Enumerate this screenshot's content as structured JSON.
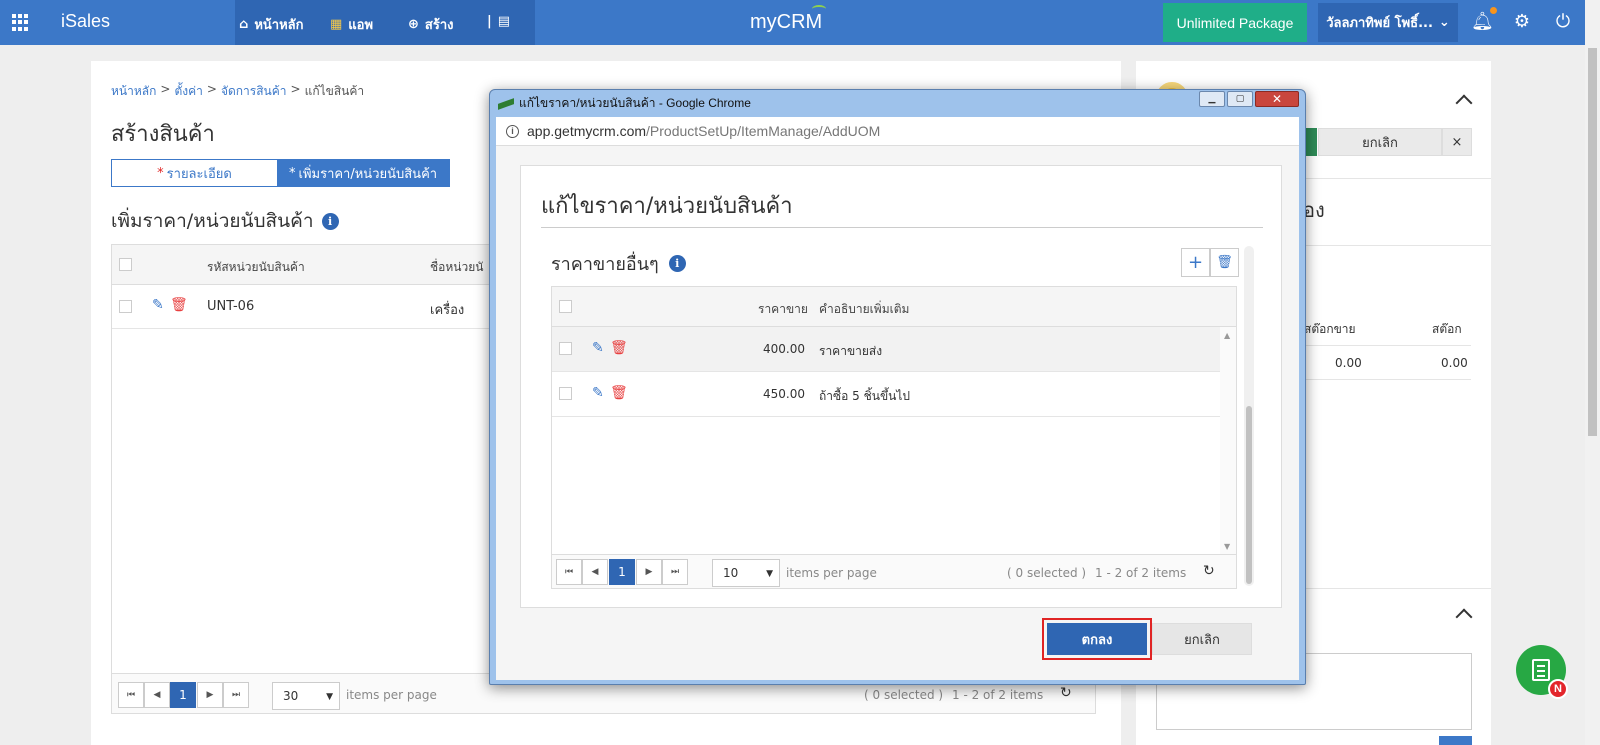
{
  "topbar": {
    "brand": "iSales",
    "nav": [
      {
        "label": "หน้าหลัก",
        "icon": "home-icon"
      },
      {
        "label": "แอพ",
        "icon": "apps-icon"
      },
      {
        "label": "สร้าง",
        "icon": "plus-circle-icon"
      }
    ],
    "center_logo": "myCRM",
    "package_label": "Unlimited Package",
    "user_label": "วัลลภาทิพย์ โพธิ์..."
  },
  "breadcrumb": [
    "หน้าหลัก",
    "ตั้งค่า",
    "จัดการสินค้า",
    "แก้ไขสินค้า"
  ],
  "breadcrumb_sep": ">",
  "page_title": "สร้างสินค้า",
  "tabs": [
    {
      "label": "รายละเอียด",
      "required": "*"
    },
    {
      "label": "เพิ่มราคา/หน่วยนับสินค้า",
      "required": "*"
    }
  ],
  "section_title": "เพิ่มราคา/หน่วยนับสินค้า",
  "main_grid": {
    "columns": [
      "รหัสหน่วยนับสินค้า",
      "ชื่อหน่วยนั"
    ],
    "rows": [
      {
        "code": "UNT-06",
        "name": "เครื่อง"
      }
    ],
    "pager": {
      "page": "1",
      "page_size": "30",
      "per_page_label": "items per page",
      "selected_label": "( 0 selected )",
      "range_label": "1 - 2 of 2 items"
    }
  },
  "right_panel": {
    "cancel_label": "ยกเลิก",
    "close_label": "×",
    "partial_heading": "อง",
    "stock_sell_header": "สต๊อกขาย",
    "stock_header": "สต๊อก",
    "stock_sell_value": "0.00",
    "stock_value": "0.00"
  },
  "popup": {
    "window_title": "แก้ไขราคา/หน่วยนับสินค้า - Google Chrome",
    "url_host": "app.getmycrm.com",
    "url_path": "/ProductSetUp/ItemManage/AddUOM",
    "dialog_title": "แก้ไขราคา/หน่วยนับสินค้า",
    "sub_title": "ราคาขายอื่นๆ",
    "columns": [
      "ราคาขาย",
      "คำอธิบายเพิ่มเติม"
    ],
    "rows": [
      {
        "price": "400.00",
        "description": "ราคาขายส่ง"
      },
      {
        "price": "450.00",
        "description": "ถ้าซื้อ 5 ชิ้นขึ้นไป"
      }
    ],
    "pager": {
      "page": "1",
      "page_size": "10",
      "per_page_label": "items per page",
      "selected_label": "( 0 selected )",
      "range_label": "1 - 2 of 2 items"
    },
    "ok_label": "ตกลง",
    "cancel_label": "ยกเลิก"
  },
  "fab_badge": "N",
  "colors": {
    "primary": "#3c78c8",
    "dark_primary": "#2f66b3",
    "package_green": "#1fae88",
    "fab_green": "#27a844",
    "delete_red": "#e84040",
    "highlight_red": "#e02424"
  }
}
